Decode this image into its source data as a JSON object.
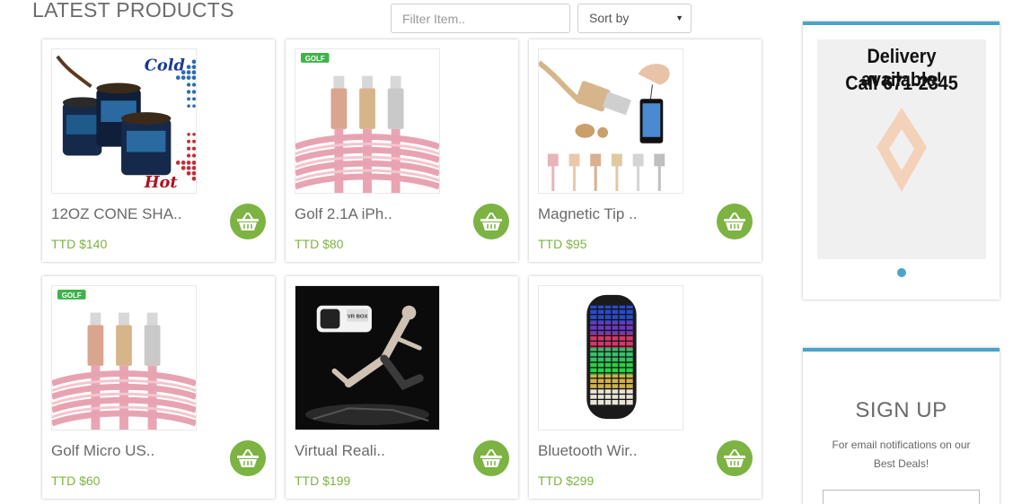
{
  "header": {
    "title": "LATEST PRODUCTS",
    "filter_placeholder": "Filter Item..",
    "sort_label": "Sort by"
  },
  "products": [
    {
      "name": "12OZ CONE SHA..",
      "price": "TTD $140",
      "image_text": [
        "Cold",
        "Hot"
      ]
    },
    {
      "name": "Golf 2.1A iPh..",
      "price": "TTD $80",
      "image_text": [
        "GOLF"
      ]
    },
    {
      "name": "Magnetic Tip ..",
      "price": "TTD $95",
      "image_text": []
    },
    {
      "name": "Golf Micro US..",
      "price": "TTD $60",
      "image_text": [
        "GOLF"
      ]
    },
    {
      "name": "Virtual Reali..",
      "price": "TTD $199",
      "image_text": [
        "VR BOX"
      ]
    },
    {
      "name": "Bluetooth Wir..",
      "price": "TTD $299",
      "image_text": []
    }
  ],
  "sidebar": {
    "ad_line1": "Delivery available!",
    "ad_line2": "Call 671-2345",
    "signup_title": "SIGN UP",
    "signup_text": "For email notifications on our Best Deals!"
  },
  "colors": {
    "accent_green": "#7cb342",
    "accent_blue": "#4aa3c8"
  }
}
